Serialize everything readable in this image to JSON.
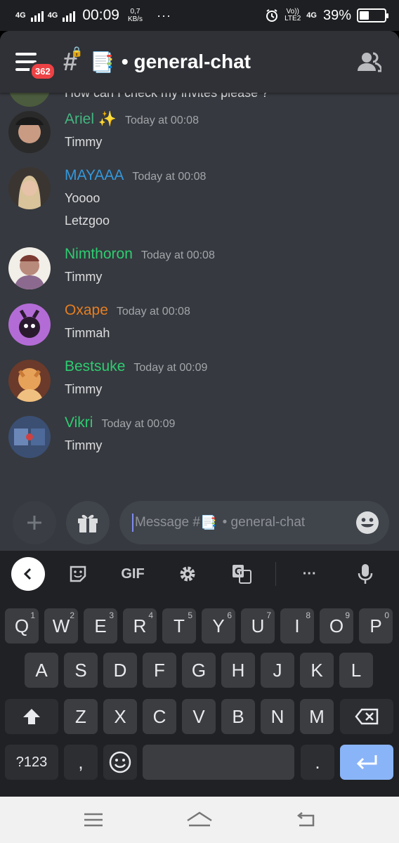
{
  "status_bar": {
    "network_1": "4G",
    "network_2": "4G",
    "time": "00:09",
    "speed_value": "0,7",
    "speed_unit": "KB/s",
    "more": "···",
    "volte_top": "Vo))",
    "volte_bottom": "LTE2",
    "network_3": "4G",
    "battery": "39%",
    "battery_level": 0.39
  },
  "header": {
    "badge": "362",
    "channel_emoji": "📑",
    "channel_name": "• general-chat"
  },
  "messages": {
    "cut_off_text": "How can I check my invites please ?",
    "items": [
      {
        "username": "Ariel ✨",
        "color": "#43b581",
        "timestamp": "Today at 00:08",
        "lines": [
          "Timmy"
        ]
      },
      {
        "username": "MAYAAA",
        "color": "#3498db",
        "timestamp": "Today at 00:08",
        "lines": [
          "Yoooo",
          "Letzgoo"
        ]
      },
      {
        "username": "Nimthoron",
        "color": "#2ecc71",
        "timestamp": "Today at 00:08",
        "lines": [
          "Timmy"
        ]
      },
      {
        "username": "Oxape",
        "color": "#e67e22",
        "timestamp": "Today at 00:08",
        "lines": [
          "Timmah"
        ]
      },
      {
        "username": "Bestsuke",
        "color": "#2ecc71",
        "timestamp": "Today at 00:09",
        "lines": [
          "Timmy"
        ]
      },
      {
        "username": "Vikri",
        "color": "#2ecc71",
        "timestamp": "Today at 00:09",
        "lines": [
          "Timmy"
        ]
      }
    ]
  },
  "composer": {
    "placeholder_prefix": "Message #",
    "placeholder_emoji": "📑",
    "placeholder_suffix": "• general-chat"
  },
  "keyboard": {
    "gif_label": "GIF",
    "more": "···",
    "row1": [
      {
        "k": "Q",
        "n": "1"
      },
      {
        "k": "W",
        "n": "2"
      },
      {
        "k": "E",
        "n": "3"
      },
      {
        "k": "R",
        "n": "4"
      },
      {
        "k": "T",
        "n": "5"
      },
      {
        "k": "Y",
        "n": "6"
      },
      {
        "k": "U",
        "n": "7"
      },
      {
        "k": "I",
        "n": "8"
      },
      {
        "k": "O",
        "n": "9"
      },
      {
        "k": "P",
        "n": "0"
      }
    ],
    "row2": [
      "A",
      "S",
      "D",
      "F",
      "G",
      "H",
      "J",
      "K",
      "L"
    ],
    "row3": [
      "Z",
      "X",
      "C",
      "V",
      "B",
      "N",
      "M"
    ],
    "symbols_label": "?123",
    "comma": ",",
    "period": "."
  },
  "colors": {
    "app_bg": "#36393f",
    "header_bg": "#2f3136",
    "badge": "#ed4245",
    "enter_key": "#8ab4f8"
  }
}
